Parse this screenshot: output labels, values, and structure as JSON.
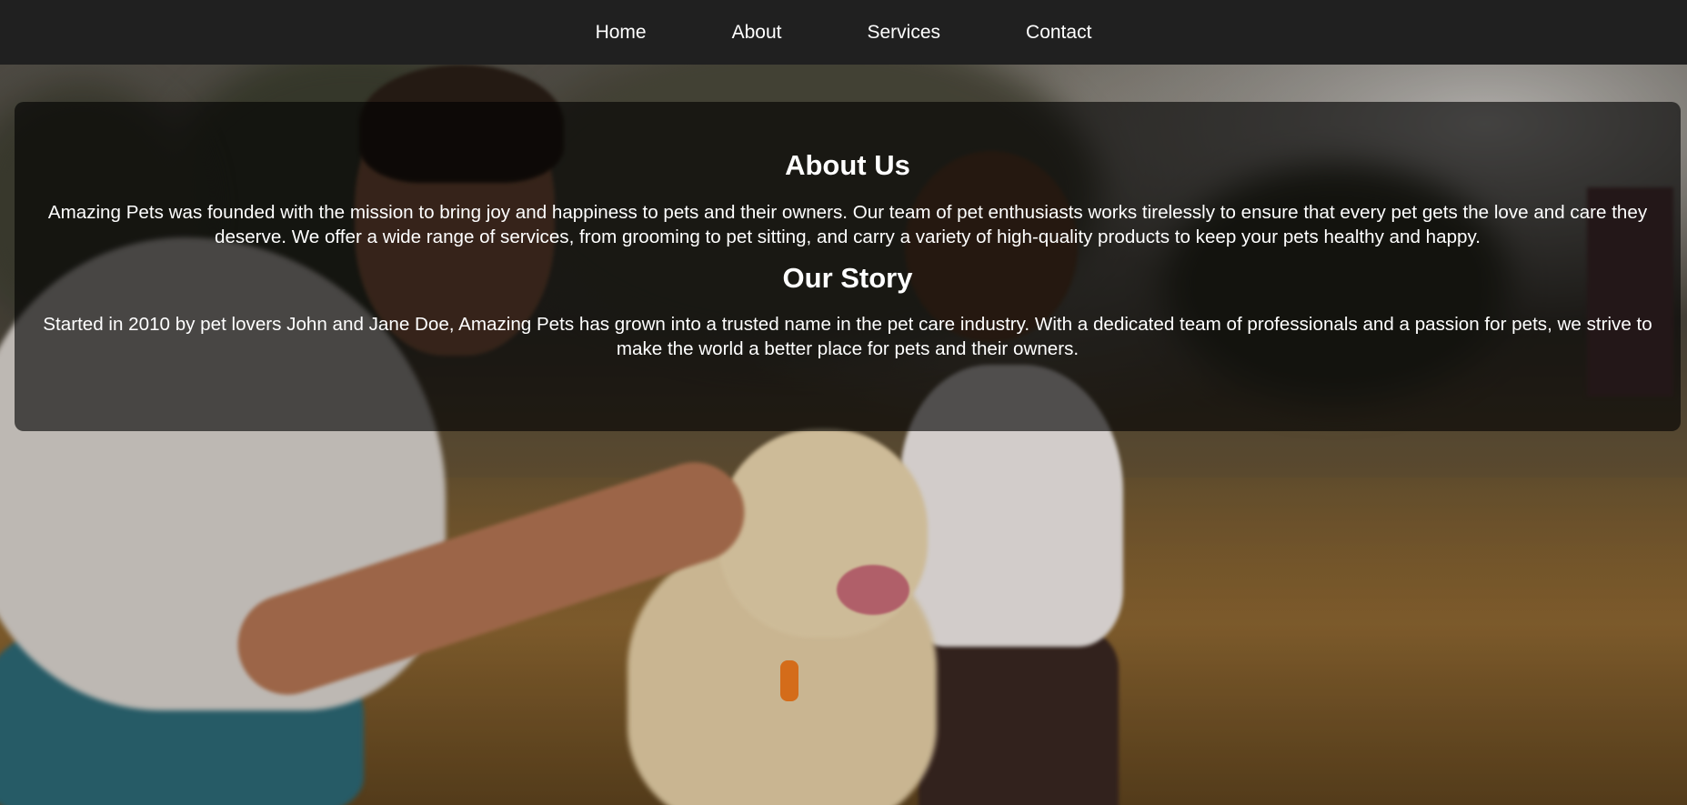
{
  "nav": {
    "items": [
      {
        "label": "Home"
      },
      {
        "label": "About"
      },
      {
        "label": "Services"
      },
      {
        "label": "Contact"
      }
    ]
  },
  "hero": {
    "image": "man-dog-child-park-photo"
  },
  "about": {
    "heading": "About Us",
    "body": "Amazing Pets was founded with the mission to bring joy and happiness to pets and their owners. Our team of pet enthusiasts works tirelessly to ensure that every pet gets the love and care they deserve. We offer a wide range of services, from grooming to pet sitting, and carry a variety of high-quality products to keep your pets healthy and happy."
  },
  "story": {
    "heading": "Our Story",
    "body": "Started in 2010 by pet lovers John and Jane Doe, Amazing Pets has grown into a trusted name in the pet care industry. With a dedicated team of professionals and a passion for pets, we strive to make the world a better place for pets and their owners."
  },
  "colors": {
    "nav_bg": "#202020",
    "nav_text": "#ffffff",
    "panel_bg": "rgba(0,0,0,0.62)",
    "panel_text": "#ffffff"
  }
}
